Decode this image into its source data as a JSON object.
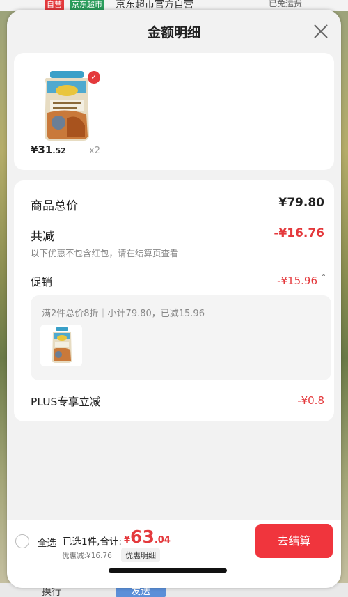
{
  "background": {
    "top_tag_1": "自营",
    "top_tag_2": "京东超市",
    "top_store": "京东超市官方自营",
    "top_shipping": "已免运费",
    "bottom_left": "换行",
    "bottom_button": "发送"
  },
  "sheet": {
    "title": "金额明细"
  },
  "product": {
    "price_main": "¥31",
    "price_decimal": ".52",
    "quantity": "x2"
  },
  "detail": {
    "total_label": "商品总价",
    "total_value": "¥79.80",
    "reduction_label": "共减",
    "reduction_value": "-¥16.76",
    "reduction_note": "以下优惠不包含红包，请在结算页查看",
    "promo_label": "促销",
    "promo_value": "-¥15.96",
    "promo_rule": "满2件总价8折｜小计79.80，已减15.96",
    "plus_label": "PLUS专享立减",
    "plus_value": "-¥0.8"
  },
  "footer": {
    "select_all": "全选",
    "selected_info": "已选1件,合计:",
    "currency": "¥",
    "total_int": "63",
    "total_dec": ".04",
    "discount_note": "优惠减:¥16.76",
    "discount_detail_button": "优惠明细",
    "checkout_button": "去结算"
  },
  "colors": {
    "accent_red": "#e4393c",
    "checkout_red": "#f0353d"
  }
}
